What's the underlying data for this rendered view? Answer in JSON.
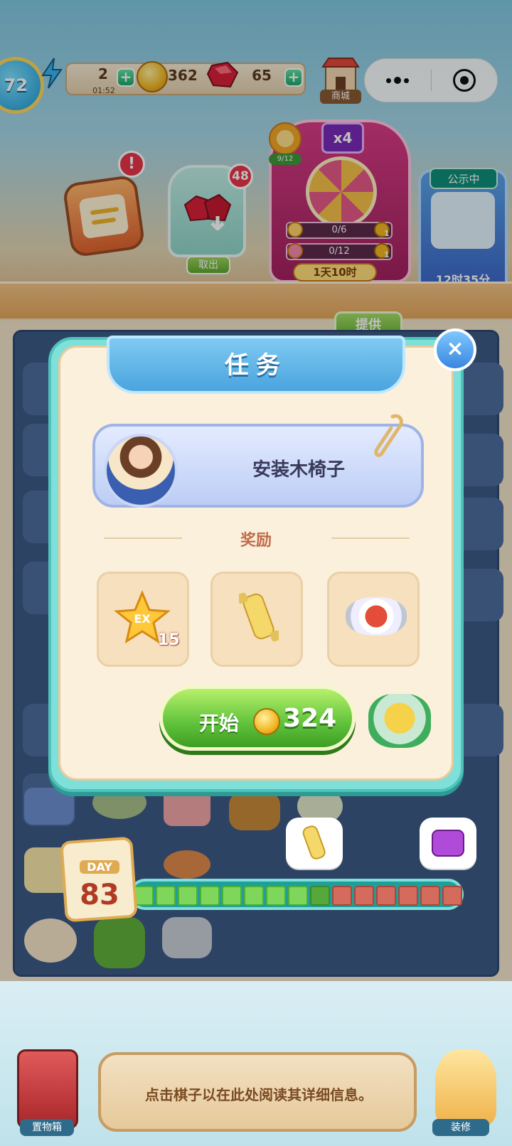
{
  "hud": {
    "level": "72",
    "energy": "2",
    "energy_timer": "01:52",
    "coins": "362",
    "gems": "65",
    "shop_label": "商城"
  },
  "events": {
    "storage_count": "48",
    "storage_take_label": "取出",
    "flower_progress": "9/12",
    "wheel_multiplier": "x4",
    "wheel_rows": [
      {
        "progress": "0/6",
        "reward": "1"
      },
      {
        "progress": "0/12",
        "reward": "1"
      }
    ],
    "wheel_timer": "1天10时",
    "notice_tag": "公示中",
    "notice_timer": "12时35分",
    "offer_label": "提供"
  },
  "modal": {
    "title": "任务",
    "task_name": "安装木椅子",
    "reward_heading": "奖励",
    "rewards": [
      {
        "icon": "ex-star-icon",
        "qty": "15"
      },
      {
        "icon": "scroll-icon",
        "qty": ""
      },
      {
        "icon": "dish-icon",
        "qty": ""
      }
    ],
    "start_label": "开始",
    "start_cost": "324",
    "close_glyph": "×"
  },
  "day": {
    "label": "DAY",
    "number": "83",
    "segments_done": 8,
    "segments_current": 1,
    "segments_todo": 6
  },
  "bottom": {
    "storage_box_label": "置物箱",
    "info_text": "点击棋子以在此处阅读其详细信息。",
    "decorate_label": "装修"
  },
  "colors": {
    "board": "#3d5a86",
    "modal_border": "#7fe0d9",
    "start_button": "#5fc23a",
    "alert_red": "#e8354a"
  }
}
